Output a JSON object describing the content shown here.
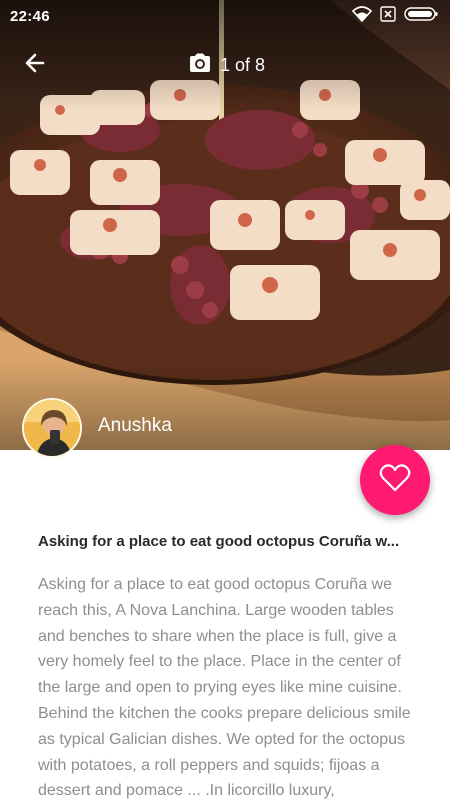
{
  "status_bar": {
    "time": "22:46",
    "icons": [
      "wifi-icon",
      "sim-off-icon",
      "battery-icon"
    ]
  },
  "toolbar": {
    "back_icon": "arrow-left-icon",
    "camera_icon": "camera-icon",
    "photo_counter": "1 of 8"
  },
  "author": {
    "name": "Anushka"
  },
  "like_button": {
    "icon": "heart-outline-icon",
    "color": "#ff1a71"
  },
  "post": {
    "title": "Asking for a place to eat good octopus Coruña w...",
    "body": "Asking for a place to eat good octopus Coruña we reach this, A Nova Lanchina. Large wooden tables and benches to share when the place is full, give a very homely feel to the place. Place in the center of the large and open to prying eyes like mine cuisine. Behind the kitchen the cooks prepare delicious smile as typical Galician dishes. We opted for the octopus with potatoes, a roll peppers and squids; fijoas a dessert and pomace ... .In licorcillo luxury,"
  }
}
